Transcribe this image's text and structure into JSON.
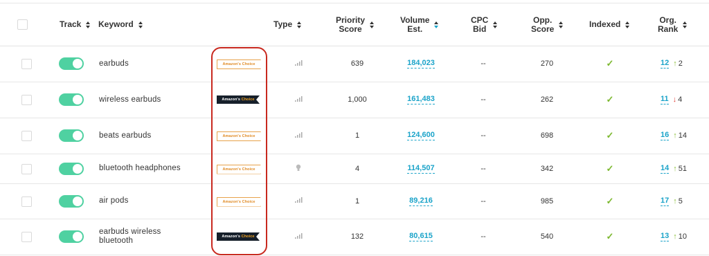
{
  "header": {
    "track": "Track",
    "keyword": "Keyword",
    "type": "Type",
    "priority_1": "Priority",
    "priority_2": "Score",
    "volume_1": "Volume",
    "volume_2": "Est.",
    "cpc_1": "CPC",
    "cpc_2": "Bid",
    "opp_1": "Opp.",
    "opp_2": "Score",
    "indexed": "Indexed",
    "org_1": "Org.",
    "org_2": "Rank"
  },
  "badge": {
    "text_light": "Amazon's Choice",
    "text_dark_a": "Amazon's",
    "text_dark_b": "Choice"
  },
  "rows": [
    {
      "keyword": "earbuds",
      "keyword2": "",
      "badge": "light",
      "type_icon": "bar-chart-icon",
      "priority": "639",
      "volume": "184,023",
      "cpc": "--",
      "opp": "270",
      "indexed": "✓",
      "rank": "12",
      "trend": "2",
      "trend_dir": "up",
      "trend_arrow": "↑"
    },
    {
      "keyword": "wireless earbuds",
      "keyword2": "",
      "badge": "dark",
      "type_icon": "bar-chart-icon",
      "priority": "1,000",
      "volume": "161,483",
      "cpc": "--",
      "opp": "262",
      "indexed": "✓",
      "rank": "11",
      "trend": "4",
      "trend_dir": "down",
      "trend_arrow": "↓"
    },
    {
      "keyword": "beats earbuds",
      "keyword2": "",
      "badge": "light",
      "type_icon": "bar-chart-icon",
      "priority": "1",
      "volume": "124,600",
      "cpc": "--",
      "opp": "698",
      "indexed": "✓",
      "rank": "16",
      "trend": "14",
      "trend_dir": "up",
      "trend_arrow": "↑"
    },
    {
      "keyword": "bluetooth headphones",
      "keyword2": "",
      "badge": "light",
      "type_icon": "lightbulb-icon",
      "priority": "4",
      "volume": "114,507",
      "cpc": "--",
      "opp": "342",
      "indexed": "✓",
      "rank": "14",
      "trend": "51",
      "trend_dir": "up",
      "trend_arrow": "↑"
    },
    {
      "keyword": "air pods",
      "keyword2": "",
      "badge": "light",
      "type_icon": "bar-chart-icon",
      "priority": "1",
      "volume": "89,216",
      "cpc": "--",
      "opp": "985",
      "indexed": "✓",
      "rank": "17",
      "trend": "5",
      "trend_dir": "up",
      "trend_arrow": "↑"
    },
    {
      "keyword": "earbuds wireless",
      "keyword2": "bluetooth",
      "badge": "dark",
      "type_icon": "bar-chart-icon",
      "priority": "132",
      "volume": "80,615",
      "cpc": "--",
      "opp": "540",
      "indexed": "✓",
      "rank": "13",
      "trend": "10",
      "trend_dir": "up",
      "trend_arrow": "↑"
    }
  ],
  "colors": {
    "toggle_on": "#4fd1a1",
    "link": "#1aa3c9",
    "check": "#7cb82f",
    "trend_up": "#8bbf3a",
    "trend_down": "#e0413a",
    "highlight": "#c8281e"
  }
}
